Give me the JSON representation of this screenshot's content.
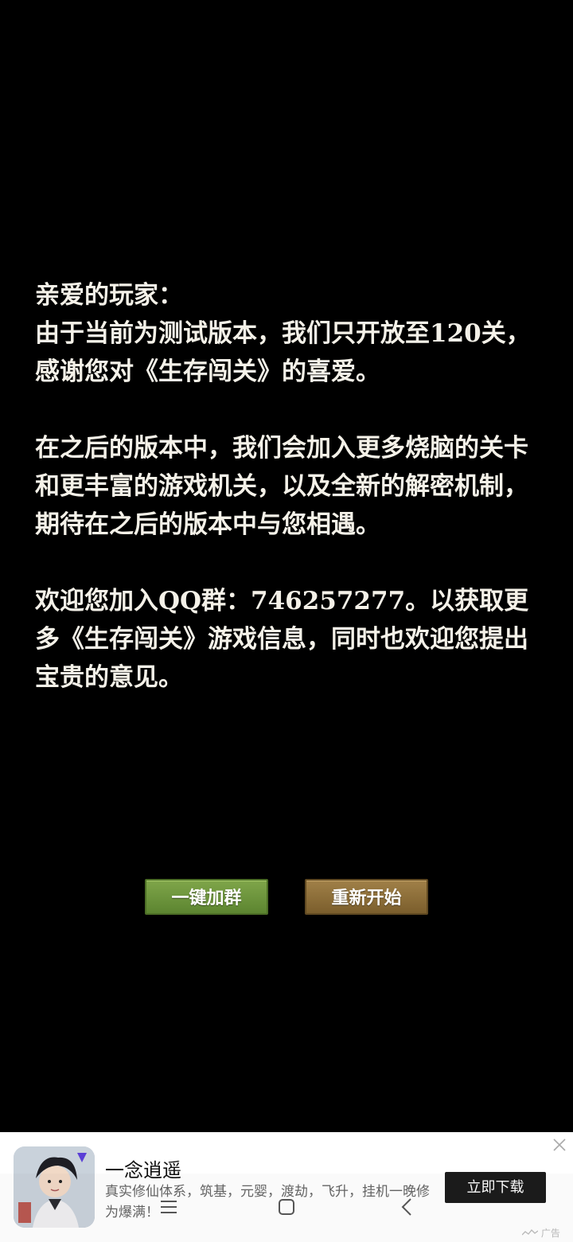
{
  "message": {
    "greeting": "亲爱的玩家：",
    "paragraph1": "由于当前为测试版本，我们只开放至120关，感谢您对《生存闯关》的喜爱。",
    "paragraph2": "在之后的版本中，我们会加入更多烧脑的关卡和更丰富的游戏机关，以及全新的解密机制，期待在之后的版本中与您相遇。",
    "paragraph3": "欢迎您加入QQ群：746257277。以获取更多《生存闯关》游戏信息，同时也欢迎您提出宝贵的意见。"
  },
  "buttons": {
    "join_group": "一键加群",
    "restart": "重新开始"
  },
  "ad": {
    "title": "一念逍遥",
    "description": "真实修仙体系，筑基，元婴，渡劫，飞升，挂机一晚修为爆满！",
    "cta": "立即下载",
    "label": "广告",
    "close_icon": "close-icon"
  },
  "navbar": {
    "icons": [
      "menu-icon",
      "home-icon",
      "back-icon"
    ]
  },
  "colors": {
    "background": "#000000",
    "text": "#f4f1e8",
    "join_button": "#6b9439",
    "restart_button": "#8c6e3a"
  }
}
